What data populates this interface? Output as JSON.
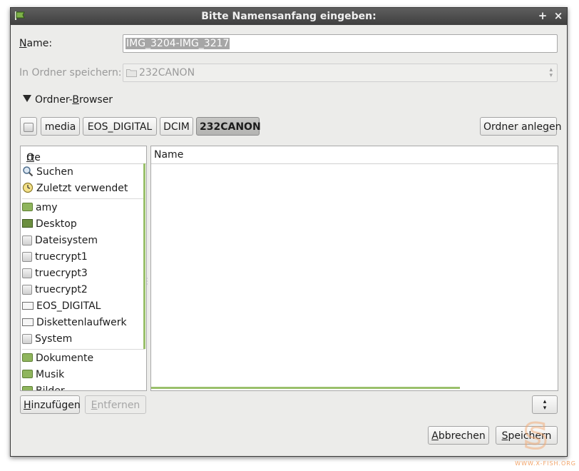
{
  "window": {
    "title": "Bitte Namensanfang eingeben:",
    "add_symbol": "+",
    "close_symbol": "×"
  },
  "name_field": {
    "label_prefix": "",
    "label_underline": "N",
    "label_rest": "ame:",
    "value": "IMG_3204-IMG_3217"
  },
  "save_in": {
    "label": "In Ordner speichern:",
    "value": "232CANON"
  },
  "browser_toggle": {
    "label_prefix": "Ordner-",
    "label_underline": "B",
    "label_rest": "rowser"
  },
  "path_bar": {
    "segments": [
      "media",
      "EOS_DIGITAL",
      "DCIM",
      "232CANON"
    ],
    "active_index": 3
  },
  "create_folder": {
    "prefix": "Ordner anle",
    "underline": "g",
    "rest": "en"
  },
  "places": {
    "header_underline": "O",
    "header_rest": "rte",
    "items": [
      {
        "label": "Suchen",
        "icon": "search-icon"
      },
      {
        "label": "Zuletzt verwendet",
        "icon": "clock-icon"
      },
      {
        "label": "amy",
        "icon": "home-folder-icon"
      },
      {
        "label": "Desktop",
        "icon": "desktop-icon"
      },
      {
        "label": "Dateisystem",
        "icon": "drive-icon"
      },
      {
        "label": "truecrypt1",
        "icon": "drive-icon"
      },
      {
        "label": "truecrypt3",
        "icon": "drive-icon"
      },
      {
        "label": "truecrypt2",
        "icon": "drive-icon"
      },
      {
        "label": "EOS_DIGITAL",
        "icon": "removable-drive-icon"
      },
      {
        "label": "Diskettenlaufwerk",
        "icon": "floppy-icon"
      },
      {
        "label": "System",
        "icon": "drive-icon"
      },
      {
        "label": "Dokumente",
        "icon": "documents-folder-icon"
      },
      {
        "label": "Musik",
        "icon": "music-folder-icon"
      },
      {
        "label": "Bilder",
        "icon": "pictures-folder-icon"
      }
    ]
  },
  "files": {
    "column_header": "Name"
  },
  "buttons": {
    "add": {
      "underline": "H",
      "rest": "inzufügen"
    },
    "remove": {
      "underline": "E",
      "rest": "ntfernen"
    },
    "cancel": {
      "underline": "A",
      "rest": "bbrechen"
    },
    "save": {
      "underline": "S",
      "rest": "peichern"
    }
  },
  "watermark": "WWW.X-FISH.ORG",
  "colors": {
    "titlebar": "#4a4a4a",
    "accent_green": "#9ac06b",
    "active_segment": "#bdbdbb"
  }
}
